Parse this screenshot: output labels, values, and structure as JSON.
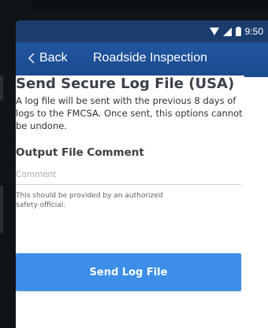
{
  "status_bar": {
    "time": "9:50"
  },
  "app_bar": {
    "back_label": "Back",
    "title": "Roadside Inspection"
  },
  "main": {
    "title": "Send Secure Log File (USA)",
    "description": "A log file will be sent with the previous 8 days of logs to the FMCSA. Once sent, this options cannot be undone.",
    "section_title": "Output File Comment",
    "comment": {
      "value": "",
      "placeholder": "Comment"
    },
    "helper_text": "This should be provided by an authorized safety official.",
    "send_button_label": "Send Log File"
  },
  "colors": {
    "status_bar": "#1b3d6e",
    "app_bar": "#21569f",
    "button": "#3d8ee8"
  }
}
